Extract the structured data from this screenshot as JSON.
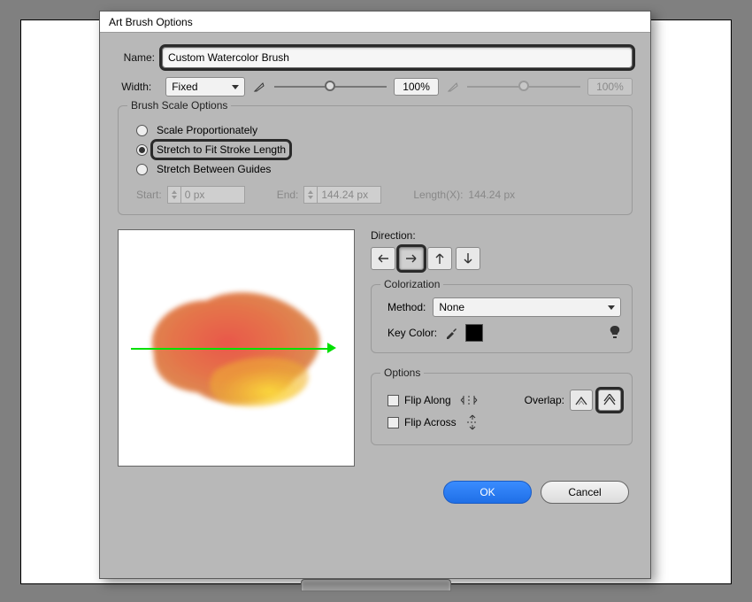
{
  "dialog": {
    "title": "Art Brush Options",
    "name_label": "Name:",
    "name_value": "Custom Watercolor Brush",
    "width_label": "Width:",
    "width_mode": "Fixed",
    "width_pct1": "100%",
    "width_pct2": "100%"
  },
  "scale": {
    "legend": "Brush Scale Options",
    "opt1": "Scale Proportionately",
    "opt2": "Stretch to Fit Stroke Length",
    "opt3": "Stretch Between Guides",
    "start_label": "Start:",
    "start_value": "0 px",
    "end_label": "End:",
    "end_value": "144.24 px",
    "length_label": "Length(X):",
    "length_value": "144.24 px"
  },
  "direction": {
    "label": "Direction:"
  },
  "colorization": {
    "legend": "Colorization",
    "method_label": "Method:",
    "method_value": "None",
    "key_label": "Key Color:"
  },
  "options": {
    "legend": "Options",
    "flip_along": "Flip Along",
    "flip_across": "Flip Across",
    "overlap_label": "Overlap:"
  },
  "footer": {
    "ok": "OK",
    "cancel": "Cancel"
  }
}
